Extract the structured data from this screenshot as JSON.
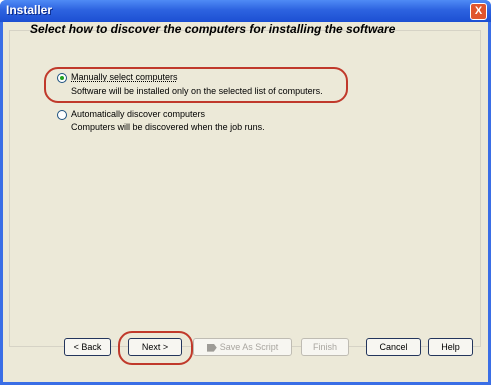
{
  "window": {
    "title": "Installer",
    "close_glyph": "X"
  },
  "heading": "Select how to discover the computers for installing the software",
  "options": [
    {
      "label": "Manually select computers",
      "description": "Software will be installed only on the selected list of computers.",
      "selected": true
    },
    {
      "label": "Automatically discover computers",
      "description": "Computers will be discovered when the job runs.",
      "selected": false
    }
  ],
  "buttons": {
    "back": "< Back",
    "next": "Next >",
    "save_script": "Save As Script",
    "finish": "Finish",
    "cancel": "Cancel",
    "help": "Help"
  },
  "colors": {
    "title_bar": "#2d63e0",
    "highlight": "#c0392b",
    "dialog_bg": "#ece9d8"
  }
}
